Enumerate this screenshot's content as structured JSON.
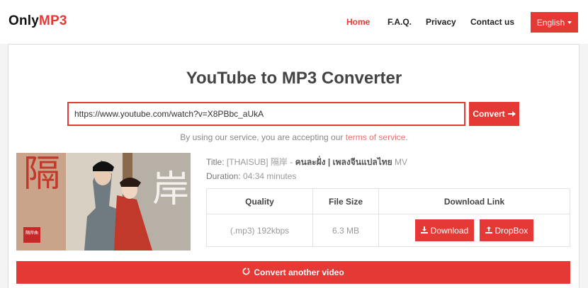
{
  "brand": {
    "name_plain": "Only",
    "name_accent": "MP3"
  },
  "nav": {
    "items": [
      {
        "label": "Home",
        "active": true
      },
      {
        "label": "F.A.Q."
      },
      {
        "label": "Privacy"
      },
      {
        "label": "Contact us"
      }
    ],
    "language": "English"
  },
  "colors": {
    "accent": "#e53935",
    "accent_light": "#e57373"
  },
  "main": {
    "title": "YouTube to MP3 Converter",
    "url_value": "https://www.youtube.com/watch?v=X8PBbc_aUkA",
    "convert_label": "Convert",
    "terms_prefix": "By using our service, you are accepting our ",
    "terms_link": "terms of service",
    "terms_suffix": "."
  },
  "video": {
    "title_label": "Title:",
    "title_prefix": "[THAISUB] 隔岸 - ",
    "title_bold": "คนละฝั่ง | เพลงจีนแปลไทย",
    "title_suffix": " MV",
    "duration_label": "Duration:",
    "duration_value": "04:34 minutes",
    "thumbnail_chars": [
      "隔",
      "岸"
    ],
    "seal_text": "隔岸曲"
  },
  "table": {
    "headers": [
      "Quality",
      "File Size",
      "Download Link"
    ],
    "rows": [
      {
        "quality": "(.mp3) 192kbps",
        "size": "6.3 MB",
        "download_label": "Download",
        "dropbox_label": "DropBox"
      }
    ]
  },
  "another_label": "Convert another video"
}
